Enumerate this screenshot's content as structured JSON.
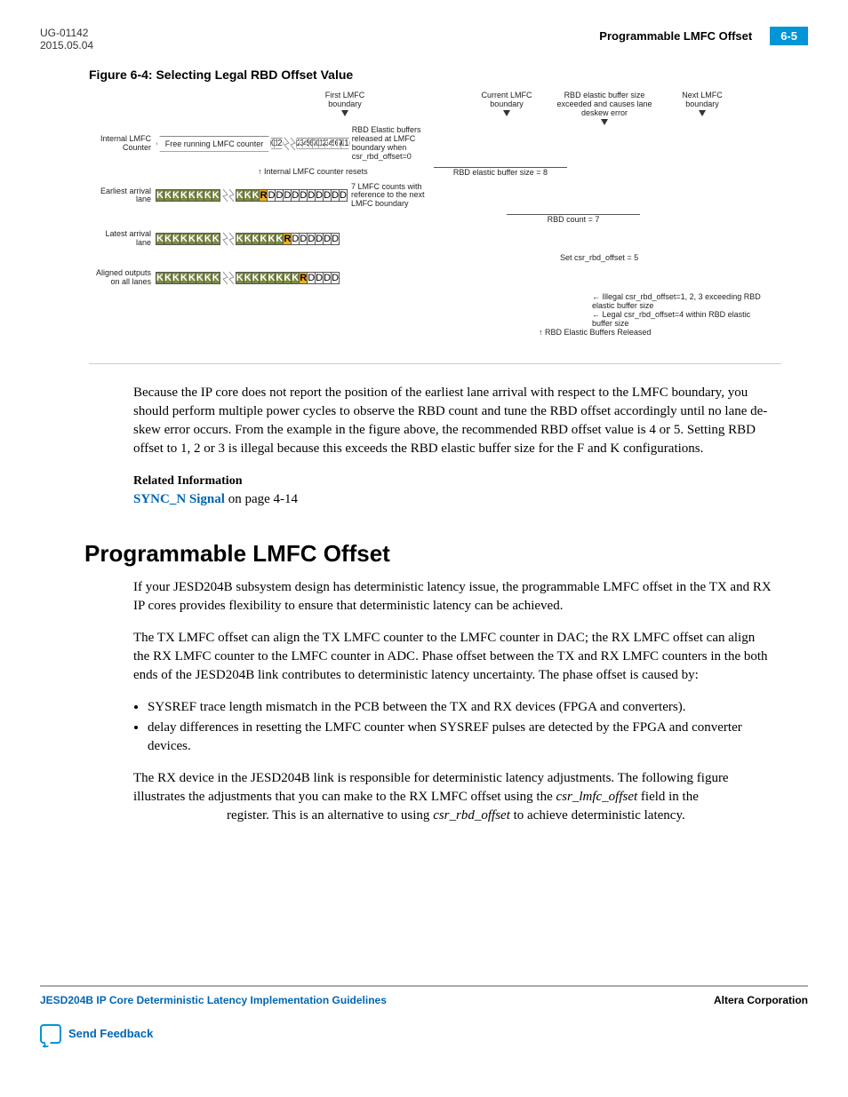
{
  "header": {
    "doc_id": "UG-01142",
    "date": "2015.05.04",
    "topic": "Programmable LMFC Offset",
    "page": "6-5"
  },
  "figure": {
    "title": "Figure 6-4: Selecting Legal RBD Offset Value",
    "top_labels": {
      "first_lmfc": "First LMFC boundary",
      "current_lmfc": "Current LMFC boundary",
      "deskew_err": "RBD elastic buffer size exceeded and causes lane deskew error",
      "next_lmfc": "Next LMFC boundary"
    },
    "rows": {
      "counter_label": "Internal LMFC Counter",
      "freerun": "Free running LMFC counter",
      "counter_reset": "Internal LMFC counter resets",
      "elastic_size": "RBD elastic buffer size = 8",
      "elastic_release_note": "RBD Elastic buffers released at LMFC boundary when csr_rbd_offset=0",
      "earliest_label": "Earliest arrival lane",
      "rbd_count": "RBD count = 7",
      "lmfc_counts_note": "7 LMFC counts with reference to the next LMFC boundary",
      "latest_label": "Latest arrival lane",
      "set_offset": "Set csr_rbd_offset = 5",
      "aligned_label": "Aligned outputs on all lanes",
      "illegal_note": "Illegal csr_rbd_offset=1, 2, 3 exceeding RBD elastic buffer size",
      "legal_note": "Legal csr_rbd_offset=4 within RBD elastic buffer size",
      "released_note": "RBD Elastic Buffers Released"
    },
    "counter_seq1": [
      "0",
      "1",
      "2"
    ],
    "counter_seq2": [
      "2",
      "3",
      "4",
      "5",
      "6",
      "7",
      "0",
      "1",
      "2",
      "3",
      "4",
      "5",
      "6",
      "7",
      "0",
      "1"
    ],
    "earliest_seq1": [
      "K",
      "K",
      "K",
      "K",
      "K",
      "K",
      "K",
      "K"
    ],
    "earliest_seq2": [
      "K",
      "K",
      "K",
      "R",
      "D",
      "D",
      "D",
      "D",
      "D",
      "D",
      "D",
      "D",
      "D",
      "D"
    ],
    "latest_seq1": [
      "K",
      "K",
      "K",
      "K",
      "K",
      "K",
      "K",
      "K"
    ],
    "latest_seq2": [
      "K",
      "K",
      "K",
      "K",
      "K",
      "K",
      "R",
      "D",
      "D",
      "D",
      "D",
      "D",
      "D"
    ],
    "aligned_seq1": [
      "K",
      "K",
      "K",
      "K",
      "K",
      "K",
      "K",
      "K"
    ],
    "aligned_seq2": [
      "K",
      "K",
      "K",
      "K",
      "K",
      "K",
      "K",
      "K",
      "R",
      "D",
      "D",
      "D",
      "D"
    ]
  },
  "body": {
    "p1": "Because the IP core does not report the position of the earliest lane arrival with respect to the LMFC boundary, you should perform multiple power cycles to observe the RBD count and tune the RBD offset accordingly until no lane de-skew error occurs. From the example in the figure above, the recommended RBD offset value is 4 or 5. Setting RBD offset to 1, 2 or 3 is illegal because this exceeds the RBD elastic buffer size for the F and K configurations.",
    "related_head": "Related Information",
    "link_text": "SYNC_N Signal",
    "link_suffix": " on page 4-14",
    "section_title": "Programmable LMFC Offset",
    "p2": "If your JESD204B subsystem design has deterministic latency issue, the programmable LMFC offset in the TX and RX IP cores provides flexibility to ensure that deterministic latency can be achieved.",
    "p3": "The TX LMFC offset can align the TX LMFC counter to the LMFC counter in DAC; the RX LMFC offset can align the RX LMFC counter to the LMFC counter in ADC. Phase offset between the TX and RX LMFC counters in the both ends of the JESD204B link contributes to deterministic latency uncertainty. The phase offset is caused by:",
    "bullets": [
      "SYSREF trace length mismatch in the PCB between the TX and RX devices (FPGA and converters).",
      "delay differences in resetting the LMFC counter when SYSREF pulses are detected by the FPGA and converter devices."
    ],
    "p4a": "The RX device in the JESD204B link is responsible for deterministic latency adjustments. The following figure illustrates the adjustments that you can make to the RX LMFC offset using the ",
    "p4_i1": "csr_lmfc_offset",
    "p4b": " field in the ",
    "p4c": " register. This is an alternative to using ",
    "p4_i2": "csr_rbd_offset",
    "p4d": " to achieve deterministic latency."
  },
  "footer": {
    "left": "JESD204B IP Core Deterministic Latency Implementation Guidelines",
    "right": "Altera Corporation",
    "feedback": "Send Feedback"
  }
}
